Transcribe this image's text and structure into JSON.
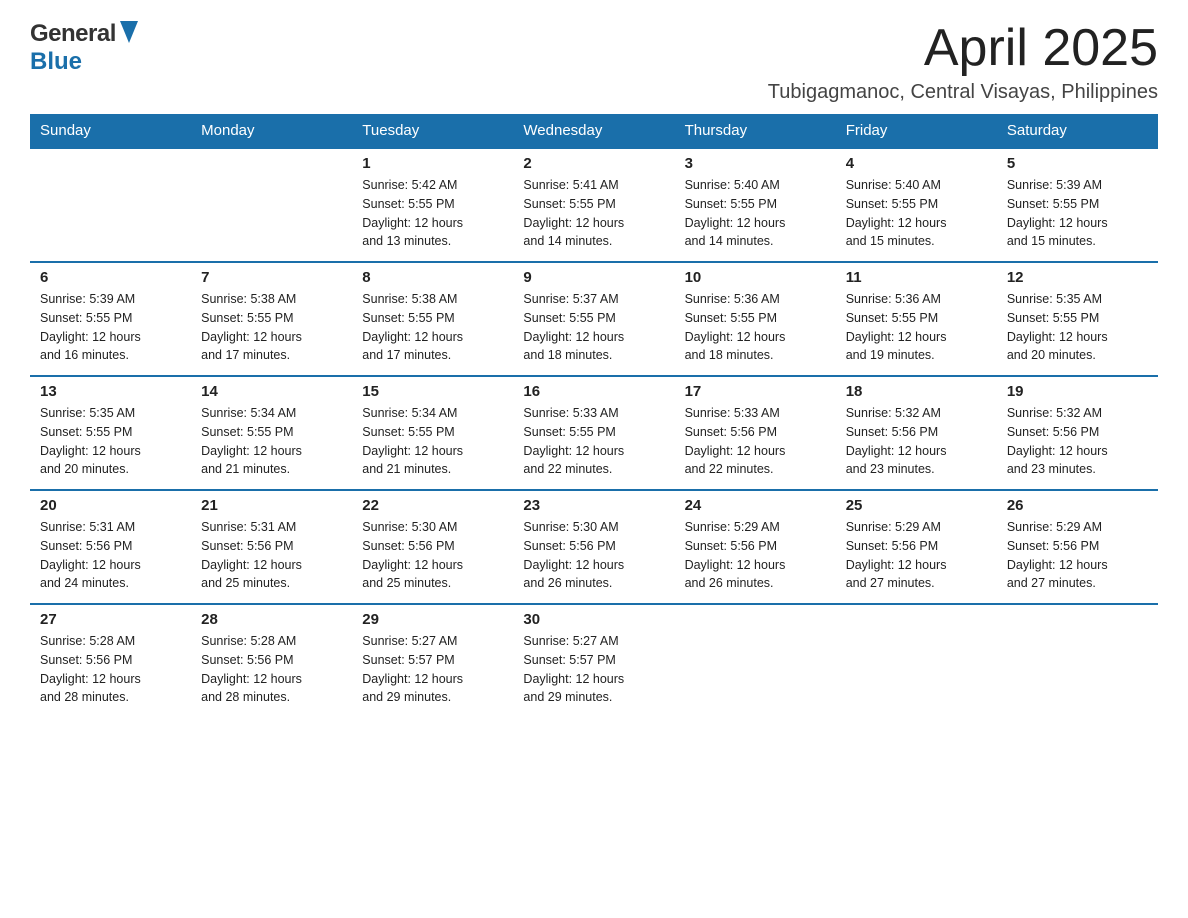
{
  "header": {
    "logo_general": "General",
    "logo_blue": "Blue",
    "month_year": "April 2025",
    "location": "Tubigagmanoc, Central Visayas, Philippines"
  },
  "calendar": {
    "days_of_week": [
      "Sunday",
      "Monday",
      "Tuesday",
      "Wednesday",
      "Thursday",
      "Friday",
      "Saturday"
    ],
    "weeks": [
      [
        {
          "day": "",
          "info": ""
        },
        {
          "day": "",
          "info": ""
        },
        {
          "day": "1",
          "info": "Sunrise: 5:42 AM\nSunset: 5:55 PM\nDaylight: 12 hours\nand 13 minutes."
        },
        {
          "day": "2",
          "info": "Sunrise: 5:41 AM\nSunset: 5:55 PM\nDaylight: 12 hours\nand 14 minutes."
        },
        {
          "day": "3",
          "info": "Sunrise: 5:40 AM\nSunset: 5:55 PM\nDaylight: 12 hours\nand 14 minutes."
        },
        {
          "day": "4",
          "info": "Sunrise: 5:40 AM\nSunset: 5:55 PM\nDaylight: 12 hours\nand 15 minutes."
        },
        {
          "day": "5",
          "info": "Sunrise: 5:39 AM\nSunset: 5:55 PM\nDaylight: 12 hours\nand 15 minutes."
        }
      ],
      [
        {
          "day": "6",
          "info": "Sunrise: 5:39 AM\nSunset: 5:55 PM\nDaylight: 12 hours\nand 16 minutes."
        },
        {
          "day": "7",
          "info": "Sunrise: 5:38 AM\nSunset: 5:55 PM\nDaylight: 12 hours\nand 17 minutes."
        },
        {
          "day": "8",
          "info": "Sunrise: 5:38 AM\nSunset: 5:55 PM\nDaylight: 12 hours\nand 17 minutes."
        },
        {
          "day": "9",
          "info": "Sunrise: 5:37 AM\nSunset: 5:55 PM\nDaylight: 12 hours\nand 18 minutes."
        },
        {
          "day": "10",
          "info": "Sunrise: 5:36 AM\nSunset: 5:55 PM\nDaylight: 12 hours\nand 18 minutes."
        },
        {
          "day": "11",
          "info": "Sunrise: 5:36 AM\nSunset: 5:55 PM\nDaylight: 12 hours\nand 19 minutes."
        },
        {
          "day": "12",
          "info": "Sunrise: 5:35 AM\nSunset: 5:55 PM\nDaylight: 12 hours\nand 20 minutes."
        }
      ],
      [
        {
          "day": "13",
          "info": "Sunrise: 5:35 AM\nSunset: 5:55 PM\nDaylight: 12 hours\nand 20 minutes."
        },
        {
          "day": "14",
          "info": "Sunrise: 5:34 AM\nSunset: 5:55 PM\nDaylight: 12 hours\nand 21 minutes."
        },
        {
          "day": "15",
          "info": "Sunrise: 5:34 AM\nSunset: 5:55 PM\nDaylight: 12 hours\nand 21 minutes."
        },
        {
          "day": "16",
          "info": "Sunrise: 5:33 AM\nSunset: 5:55 PM\nDaylight: 12 hours\nand 22 minutes."
        },
        {
          "day": "17",
          "info": "Sunrise: 5:33 AM\nSunset: 5:56 PM\nDaylight: 12 hours\nand 22 minutes."
        },
        {
          "day": "18",
          "info": "Sunrise: 5:32 AM\nSunset: 5:56 PM\nDaylight: 12 hours\nand 23 minutes."
        },
        {
          "day": "19",
          "info": "Sunrise: 5:32 AM\nSunset: 5:56 PM\nDaylight: 12 hours\nand 23 minutes."
        }
      ],
      [
        {
          "day": "20",
          "info": "Sunrise: 5:31 AM\nSunset: 5:56 PM\nDaylight: 12 hours\nand 24 minutes."
        },
        {
          "day": "21",
          "info": "Sunrise: 5:31 AM\nSunset: 5:56 PM\nDaylight: 12 hours\nand 25 minutes."
        },
        {
          "day": "22",
          "info": "Sunrise: 5:30 AM\nSunset: 5:56 PM\nDaylight: 12 hours\nand 25 minutes."
        },
        {
          "day": "23",
          "info": "Sunrise: 5:30 AM\nSunset: 5:56 PM\nDaylight: 12 hours\nand 26 minutes."
        },
        {
          "day": "24",
          "info": "Sunrise: 5:29 AM\nSunset: 5:56 PM\nDaylight: 12 hours\nand 26 minutes."
        },
        {
          "day": "25",
          "info": "Sunrise: 5:29 AM\nSunset: 5:56 PM\nDaylight: 12 hours\nand 27 minutes."
        },
        {
          "day": "26",
          "info": "Sunrise: 5:29 AM\nSunset: 5:56 PM\nDaylight: 12 hours\nand 27 minutes."
        }
      ],
      [
        {
          "day": "27",
          "info": "Sunrise: 5:28 AM\nSunset: 5:56 PM\nDaylight: 12 hours\nand 28 minutes."
        },
        {
          "day": "28",
          "info": "Sunrise: 5:28 AM\nSunset: 5:56 PM\nDaylight: 12 hours\nand 28 minutes."
        },
        {
          "day": "29",
          "info": "Sunrise: 5:27 AM\nSunset: 5:57 PM\nDaylight: 12 hours\nand 29 minutes."
        },
        {
          "day": "30",
          "info": "Sunrise: 5:27 AM\nSunset: 5:57 PM\nDaylight: 12 hours\nand 29 minutes."
        },
        {
          "day": "",
          "info": ""
        },
        {
          "day": "",
          "info": ""
        },
        {
          "day": "",
          "info": ""
        }
      ]
    ]
  }
}
